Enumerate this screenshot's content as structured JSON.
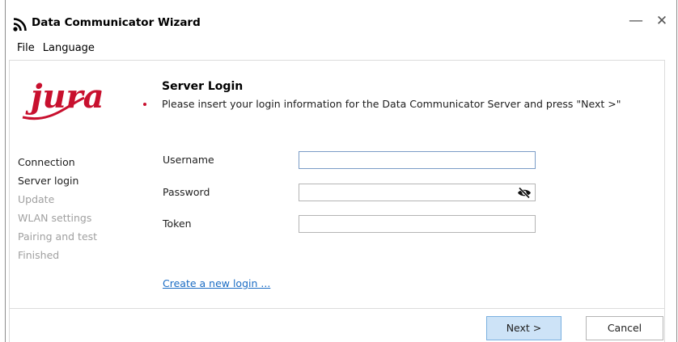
{
  "window": {
    "title": "Data Communicator Wizard",
    "minimize_glyph": "—",
    "close_glyph": "✕"
  },
  "menu": [
    "File",
    "Language"
  ],
  "logo": {
    "text": "jura",
    "color": "#c8102e"
  },
  "header": {
    "title": "Server Login",
    "description": "Please insert your login information for the Data Communicator Server and press \"Next >\""
  },
  "steps": [
    {
      "label": "Connection",
      "state": "done"
    },
    {
      "label": "Server login",
      "state": "done"
    },
    {
      "label": "Update",
      "state": "pending"
    },
    {
      "label": "WLAN settings",
      "state": "pending"
    },
    {
      "label": "Pairing and test",
      "state": "pending"
    },
    {
      "label": "Finished",
      "state": "pending"
    }
  ],
  "form": {
    "username": {
      "label": "Username",
      "value": ""
    },
    "password": {
      "label": "Password",
      "value": "",
      "toggle_icon": "eye-slash-icon"
    },
    "token": {
      "label": "Token",
      "value": ""
    }
  },
  "link": {
    "create_login": "Create a new login ..."
  },
  "buttons": {
    "next": "Next >",
    "cancel": "Cancel"
  },
  "colors": {
    "accent": "#1a6cc4",
    "primary_button_bg": "#cde3f7",
    "disabled_text": "#a0a0a0",
    "logo_red": "#c8102e"
  }
}
